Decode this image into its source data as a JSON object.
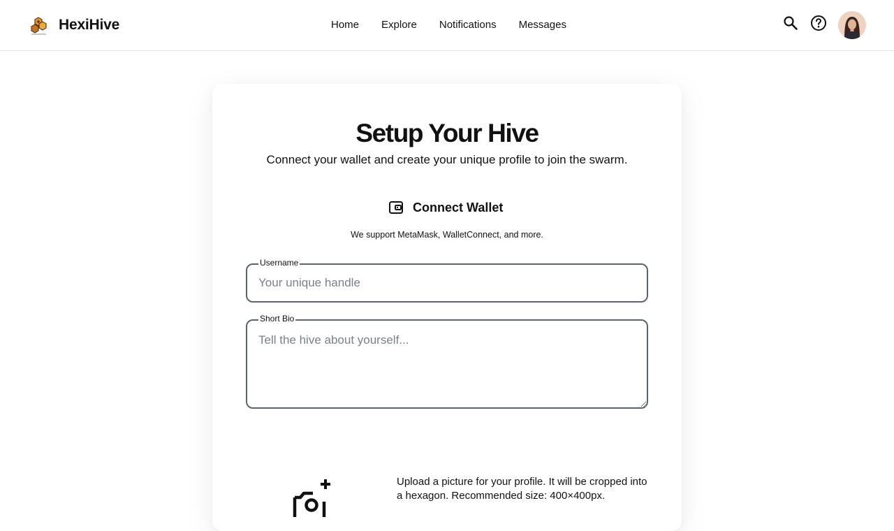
{
  "header": {
    "brand": "HexiHive",
    "nav": [
      "Home",
      "Explore",
      "Notifications",
      "Messages"
    ],
    "icons": {
      "logo": "hexihive-logo-icon",
      "search": "search-icon",
      "help": "help-circle-icon",
      "avatar": "user-avatar"
    }
  },
  "card": {
    "title": "Setup Your Hive",
    "subtitle": "Connect your wallet and create your unique profile to join the swarm.",
    "wallet": {
      "button_label": "Connect Wallet",
      "icon": "wallet-icon",
      "note": "We support MetaMask, WalletConnect, and more."
    },
    "username": {
      "label": "Username",
      "value": "",
      "placeholder": "Your unique handle"
    },
    "bio": {
      "label": "Short Bio",
      "value": "",
      "placeholder": "Tell the hive about yourself..."
    },
    "upload": {
      "icon": "add-photo-icon",
      "note": "Upload a picture for your profile. It will be cropped into a hexagon. Recommended size: 400×400px."
    }
  },
  "colors": {
    "text": "#111111",
    "border": "#5b6270",
    "placeholder": "#7b8088",
    "logo_orange": "#e8912a"
  }
}
